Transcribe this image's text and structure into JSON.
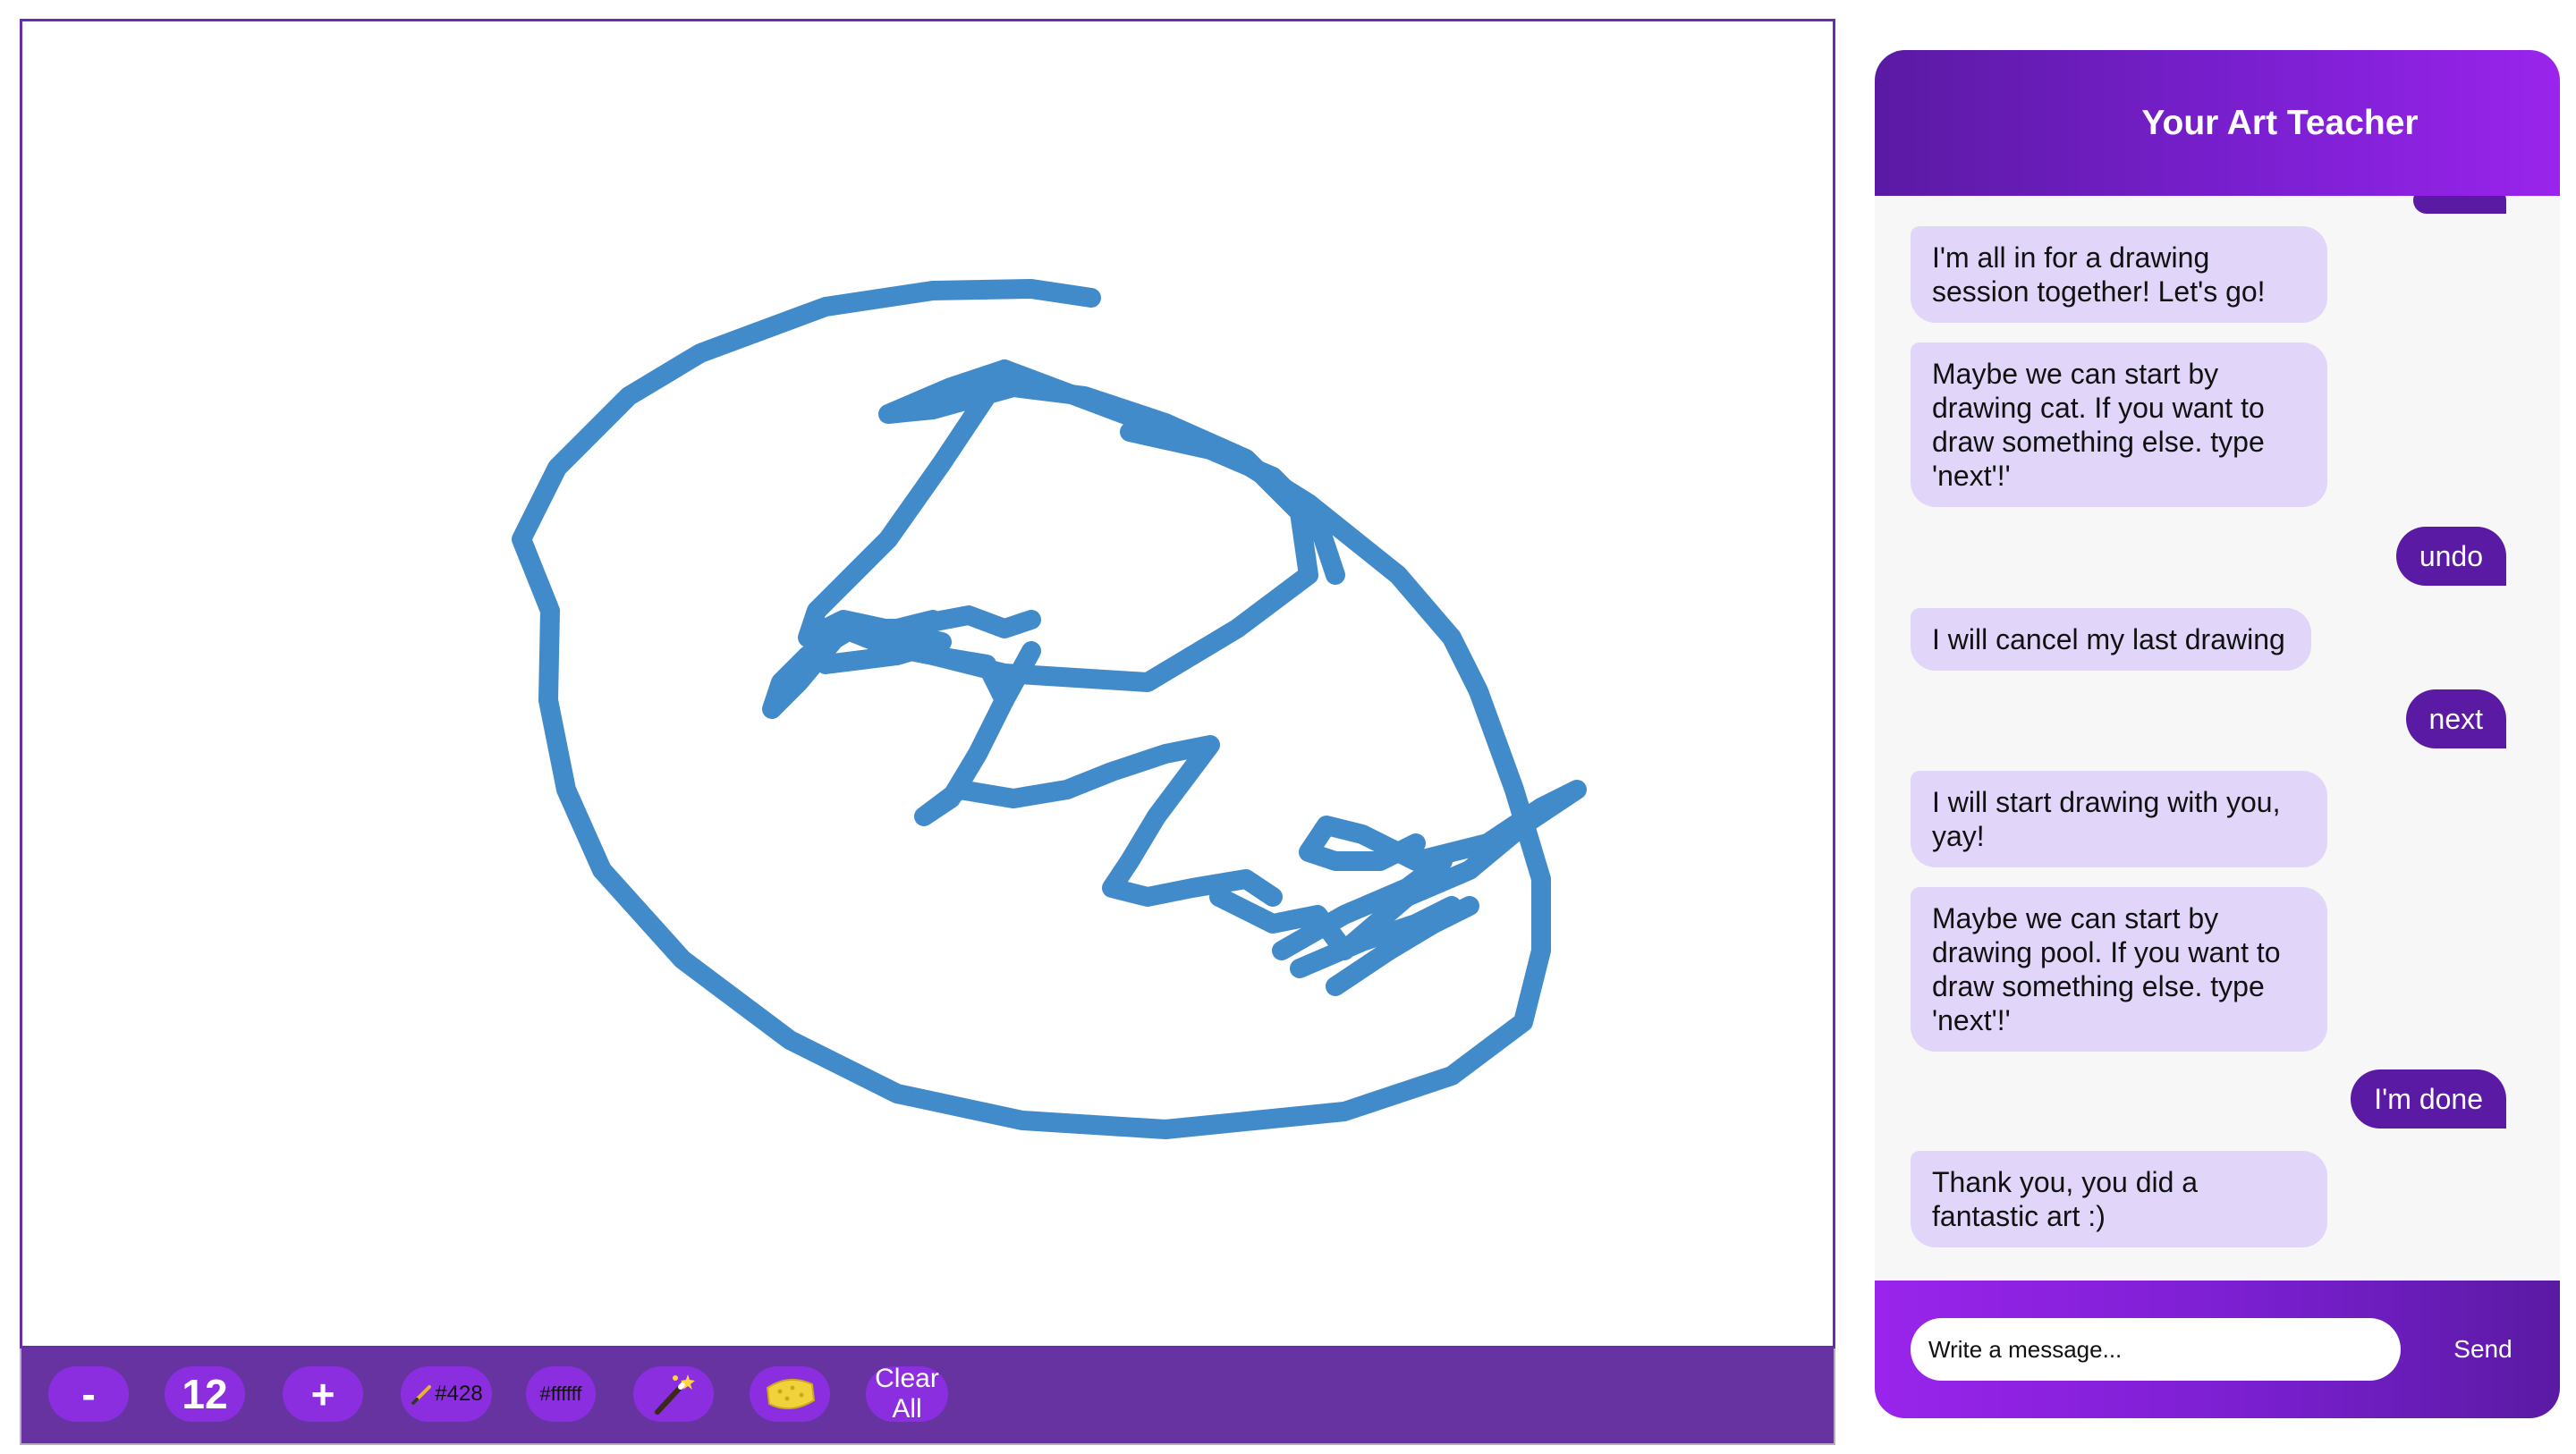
{
  "canvas": {
    "stroke_color": "#428bca",
    "stroke_width": 22
  },
  "toolbar": {
    "decrease_label": "-",
    "brush_size": "12",
    "increase_label": "+",
    "brush_color_label": "#428",
    "background_color_label": "#ffffff",
    "clear_all_label": "Clear All"
  },
  "chat": {
    "title": "Your Art Teacher",
    "messages": [
      {
        "role": "bot",
        "text": "I'm all in for a drawing session together! Let's go!"
      },
      {
        "role": "bot",
        "text": "Maybe we can start by drawing cat. If you want to draw something else. type 'next'!'"
      },
      {
        "role": "user",
        "text": "undo"
      },
      {
        "role": "bot",
        "text": "I will cancel my last drawing"
      },
      {
        "role": "user",
        "text": "next"
      },
      {
        "role": "bot",
        "text": "I will start drawing with you, yay!"
      },
      {
        "role": "bot",
        "text": "Maybe we can start by drawing pool. If you want to draw something else. type 'next'!'"
      },
      {
        "role": "user",
        "text": "I'm done"
      },
      {
        "role": "bot",
        "text": "Thank you, you did a fantastic art :)"
      }
    ],
    "input_placeholder": "Write a message...",
    "send_label": "Send"
  },
  "colors": {
    "accent": "#6633a1",
    "button": "#8b2ee0",
    "bot_bubble": "#e1d6fa",
    "user_bubble": "#5a1aa3"
  }
}
